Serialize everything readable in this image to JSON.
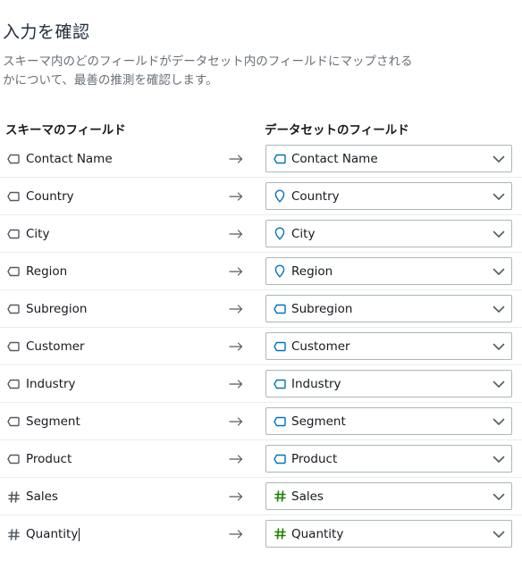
{
  "page": {
    "title": "入力を確認",
    "description": "スキーマ内のどのフィールドがデータセット内のフィールドにマップされるかについて、最善の推測を確認します。"
  },
  "columns": {
    "schema": "スキーマのフィールド",
    "dataset": "データセットのフィールド"
  },
  "colors": {
    "dimension_icon": "#0073bb",
    "measure_icon": "#1d8102",
    "neutral_icon": "#545b64"
  },
  "rows": [
    {
      "schema_field": "Contact Name",
      "schema_icon": "dimension-tag-icon",
      "dataset_field": "Contact Name",
      "dataset_icon": "dimension-tag-icon"
    },
    {
      "schema_field": "Country",
      "schema_icon": "dimension-tag-icon",
      "dataset_field": "Country",
      "dataset_icon": "geo-pin-icon"
    },
    {
      "schema_field": "City",
      "schema_icon": "dimension-tag-icon",
      "dataset_field": "City",
      "dataset_icon": "geo-pin-icon"
    },
    {
      "schema_field": "Region",
      "schema_icon": "dimension-tag-icon",
      "dataset_field": "Region",
      "dataset_icon": "geo-pin-icon"
    },
    {
      "schema_field": "Subregion",
      "schema_icon": "dimension-tag-icon",
      "dataset_field": "Subregion",
      "dataset_icon": "dimension-tag-icon"
    },
    {
      "schema_field": "Customer",
      "schema_icon": "dimension-tag-icon",
      "dataset_field": "Customer",
      "dataset_icon": "dimension-tag-icon"
    },
    {
      "schema_field": "Industry",
      "schema_icon": "dimension-tag-icon",
      "dataset_field": "Industry",
      "dataset_icon": "dimension-tag-icon"
    },
    {
      "schema_field": "Segment",
      "schema_icon": "dimension-tag-icon",
      "dataset_field": "Segment",
      "dataset_icon": "dimension-tag-icon"
    },
    {
      "schema_field": "Product",
      "schema_icon": "dimension-tag-icon",
      "dataset_field": "Product",
      "dataset_icon": "dimension-tag-icon"
    },
    {
      "schema_field": "Sales",
      "schema_icon": "measure-hash-icon",
      "dataset_field": "Sales",
      "dataset_icon": "measure-hash-icon"
    },
    {
      "schema_field": "Quantity",
      "schema_icon": "measure-hash-icon",
      "dataset_field": "Quantity",
      "dataset_icon": "measure-hash-icon"
    }
  ]
}
